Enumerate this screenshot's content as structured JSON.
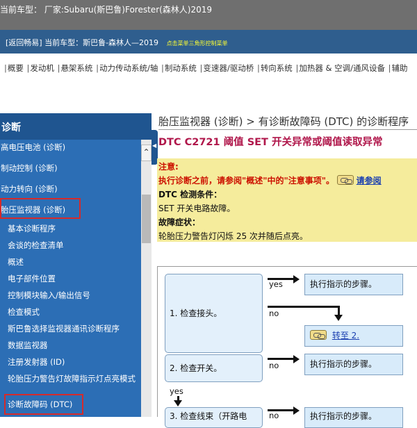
{
  "header": {
    "vehicle_label": "当前车型：",
    "vehicle_value": "厂家:Subaru(斯巴鲁)Forester(森林人)2019"
  },
  "nav": {
    "back_link": "[返回畅易]",
    "current": "当前车型：斯巴鲁-森林人—2019",
    "hint": "点击菜单三角形控制菜单"
  },
  "menu": {
    "items": [
      "概要",
      "发动机",
      "悬架系统",
      "动力传动系统/轴",
      "制动系统",
      "变速器/驱动桥",
      "转向系统",
      "加热器 & 空调/通风设备",
      "辅助"
    ]
  },
  "sidebar": {
    "heading": "诊断",
    "top_items": [
      "高电压电池 (诊断)",
      "制动控制 (诊断)",
      "动力转向 (诊断)",
      "胎压监视器 (诊断)"
    ],
    "sub_items": [
      "基本诊断程序",
      "会谈的检查清单",
      "概述",
      "电子部件位置",
      "控制模块输入/输出信号",
      "检查模式",
      "斯巴鲁选择监视器通讯诊断程序",
      "数据监视器",
      "注册发射器 (ID)",
      "轮胎压力警告灯故障指示灯点亮模式",
      "诊断故障码 (DTC)"
    ],
    "scroll_up_icon": "chevron-up-icon",
    "colors": {
      "background": "#2c6eb5",
      "selected_border": "#d62a2a"
    }
  },
  "content": {
    "breadcrumb": "胎压监视器 (诊断) > 有诊断故障码 (DTC) 的诊断程序",
    "dtc_title": "DTC C2721 阈值 SET 开关异常或阈值读取异常",
    "note": {
      "caution_heading": "注意:",
      "caution_text": "执行诊断之前，请参阅\"概述\"中的\"注意事项\"。",
      "caution_link": "请参阅",
      "condition_label": "DTC 检测条件：",
      "condition_text": "SET 开关电路故障。",
      "symptom_label": "故障症状：",
      "symptom_text": "轮胎压力警告灯闪烁 25 次并随后点亮。"
    },
    "flow": {
      "step1": "1. 检查接头。",
      "step2": "2. 检查开关。",
      "step3": "3. 检查线束（开路电",
      "yes": "yes",
      "no": "no",
      "result_ok": "执行指示的步骤。",
      "goto2": "转至 2."
    }
  }
}
